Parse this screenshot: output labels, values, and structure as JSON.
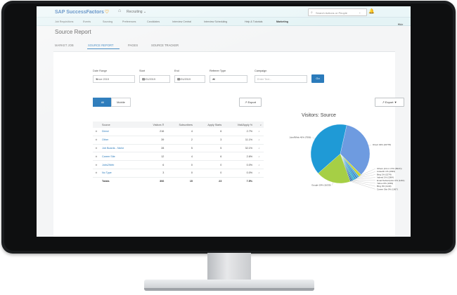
{
  "app": {
    "brand": "SAP SuccessFactors",
    "module": "Recruiting"
  },
  "search": {
    "placeholder": "Search Actions or People"
  },
  "subnav": [
    "Job Requisitions",
    "Events",
    "Sourcing",
    "Preferences",
    "Candidates",
    "Interview Central",
    "Interview Scheduling",
    "Help & Tutorials",
    "Marketing"
  ],
  "hide_label": "Hide",
  "page": {
    "title": "Source Report"
  },
  "tabs": [
    "MARKET JOB",
    "SOURCE REPORT",
    "PAGES",
    "SOURCE TRACKER"
  ],
  "filters": {
    "date_range": {
      "label": "Date Range",
      "value": "Since 2015"
    },
    "start": {
      "label": "Start",
      "value": "01/01/2019"
    },
    "end": {
      "label": "End",
      "value": "02/01/2019"
    },
    "referrer_type": {
      "label": "Referrer Type",
      "value": "All"
    },
    "campaign": {
      "label": "Campaign",
      "placeholder": "Enter Text..."
    },
    "go_label": "Go"
  },
  "toggle": {
    "all": "All",
    "mobile": "Mobile"
  },
  "export_label": "Export",
  "export_menu_label": "Export ▼",
  "table": {
    "columns": [
      "Source",
      "Visitors",
      "Subscribers",
      "Apply Starts",
      "Visit/Apply %"
    ],
    "rows": [
      {
        "source": "Direct",
        "visitors": "216",
        "subscribers": "4",
        "apply_starts": "6",
        "rate": "2.7%"
      },
      {
        "source": "Other",
        "visitors": "39",
        "subscribers": "2",
        "apply_starts": "3",
        "rate": "11.1%"
      },
      {
        "source": "Job Boards - Niche",
        "visitors": "28",
        "subscribers": "5",
        "apply_starts": "5",
        "rate": "32.1%"
      },
      {
        "source": "Career Site",
        "visitors": "12",
        "subscribers": "4",
        "apply_starts": "6",
        "rate": "2.6%"
      },
      {
        "source": "Jobs2Web",
        "visitors": "6",
        "subscribers": "0",
        "apply_starts": "0",
        "rate": "0.0%"
      },
      {
        "source": "No Type",
        "visitors": "3",
        "subscribers": "0",
        "apply_starts": "0",
        "rate": "0.0%"
      }
    ],
    "totals": {
      "label": "Totals",
      "visitors": "306",
      "subscribers": "15",
      "apply_starts": "23",
      "rate": "7.5%"
    }
  },
  "chart_data": {
    "type": "pie",
    "title": "Visitors: Source",
    "slices": [
      {
        "label": "Direct 34% (20778)",
        "value": 34,
        "color": "#6e9be0"
      },
      {
        "label": "Others (13 in 1.5% (5647))",
        "value": 1.5,
        "color": "#c9d53a"
      },
      {
        "label": "LinkedIn 1% (2093)",
        "value": 1,
        "color": "#4aa9d9"
      },
      {
        "label": "Bing 1% (1574)",
        "value": 1,
        "color": "#3a88c5"
      },
      {
        "label": "Indeed 1% (1564)",
        "value": 1,
        "color": "#2f9ad6"
      },
      {
        "label": "Email Subscription 0% (1461)",
        "value": 0.8,
        "color": "#29b1c4"
      },
      {
        "label": "Yahoo 0% (1049)",
        "value": 0.6,
        "color": "#2578b6"
      },
      {
        "label": "Bing 0% (1140)",
        "value": 0.6,
        "color": "#1f6aa8"
      },
      {
        "label": "Career Site 0% (1067)",
        "value": 0.5,
        "color": "#1a5d99"
      },
      {
        "label": "Google 19% (11030)",
        "value": 19,
        "color": "#a6cf45"
      },
      {
        "label": "JobsRWeb 40% (7996)",
        "value": 40,
        "color": "#1f9ad6"
      }
    ]
  },
  "colors": {
    "accent": "#2b7bbb",
    "header_bg": "#eaf6f8",
    "monitor": "#1b1d1f"
  }
}
